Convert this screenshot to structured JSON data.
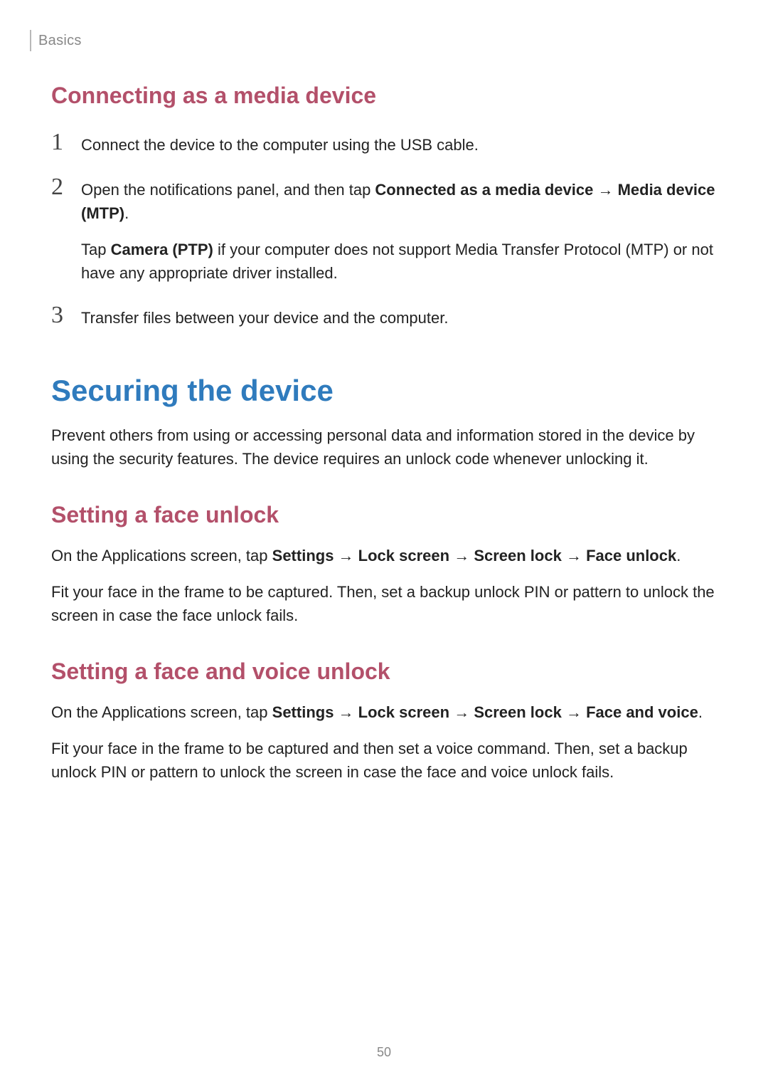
{
  "breadcrumb": "Basics",
  "section1": {
    "heading": "Connecting as a media device",
    "steps": [
      {
        "num": "1",
        "paras": [
          [
            {
              "t": "Connect the device to the computer using the USB cable."
            }
          ]
        ]
      },
      {
        "num": "2",
        "paras": [
          [
            {
              "t": "Open the notifications panel, and then tap "
            },
            {
              "t": "Connected as a media device",
              "b": true
            },
            {
              "t": " → ",
              "arrow": true
            },
            {
              "t": "Media device (MTP)",
              "b": true
            },
            {
              "t": "."
            }
          ],
          [
            {
              "t": "Tap "
            },
            {
              "t": "Camera (PTP)",
              "b": true
            },
            {
              "t": " if your computer does not support Media Transfer Protocol (MTP) or not have any appropriate driver installed."
            }
          ]
        ]
      },
      {
        "num": "3",
        "paras": [
          [
            {
              "t": "Transfer files between your device and the computer."
            }
          ]
        ]
      }
    ]
  },
  "h1": "Securing the device",
  "intro": "Prevent others from using or accessing personal data and information stored in the device by using the security features. The device requires an unlock code whenever unlocking it.",
  "section2": {
    "heading": "Setting a face unlock",
    "paras": [
      [
        {
          "t": "On the Applications screen, tap "
        },
        {
          "t": "Settings",
          "b": true
        },
        {
          "t": " → ",
          "arrow": true
        },
        {
          "t": "Lock screen",
          "b": true
        },
        {
          "t": " → ",
          "arrow": true
        },
        {
          "t": "Screen lock",
          "b": true
        },
        {
          "t": " → ",
          "arrow": true
        },
        {
          "t": "Face unlock",
          "b": true
        },
        {
          "t": "."
        }
      ],
      [
        {
          "t": "Fit your face in the frame to be captured. Then, set a backup unlock PIN or pattern to unlock the screen in case the face unlock fails."
        }
      ]
    ]
  },
  "section3": {
    "heading": "Setting a face and voice unlock",
    "paras": [
      [
        {
          "t": "On the Applications screen, tap "
        },
        {
          "t": "Settings",
          "b": true
        },
        {
          "t": " → ",
          "arrow": true
        },
        {
          "t": "Lock screen",
          "b": true
        },
        {
          "t": " → ",
          "arrow": true
        },
        {
          "t": "Screen lock",
          "b": true
        },
        {
          "t": " → ",
          "arrow": true
        },
        {
          "t": "Face and voice",
          "b": true
        },
        {
          "t": "."
        }
      ],
      [
        {
          "t": "Fit your face in the frame to be captured and then set a voice command. Then, set a backup unlock PIN or pattern to unlock the screen in case the face and voice unlock fails."
        }
      ]
    ]
  },
  "pageNumber": "50"
}
